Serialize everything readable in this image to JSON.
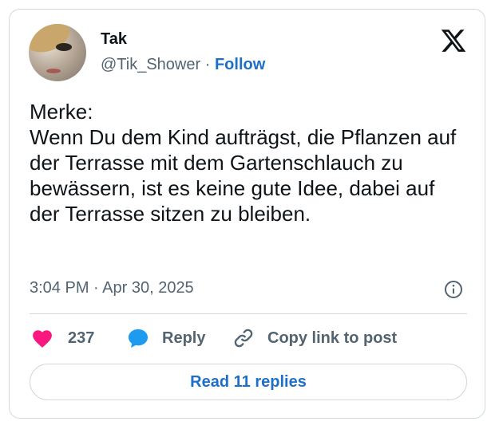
{
  "author": {
    "name": "Tak",
    "handle": "@Tik_Shower",
    "separator": "·",
    "follow_label": "Follow"
  },
  "tweet": {
    "text": "Merke:\nWenn Du dem Kind aufträgst, die Pflanzen auf der Terrasse mit dem Gartenschlauch zu bewässern, ist es keine gute Idee, dabei auf der Terrasse sitzen zu bleiben.",
    "timestamp": "3:04 PM · Apr 30, 2025"
  },
  "actions": {
    "like_count": "237",
    "reply_label": "Reply",
    "copy_label": "Copy link to post"
  },
  "read_replies_label": "Read 11 replies",
  "icons": {
    "logo": "x-logo-icon",
    "info": "info-icon",
    "like": "heart-icon",
    "reply": "speech-bubble-icon",
    "copy": "link-icon"
  },
  "colors": {
    "heart": "#f91880",
    "reply_bubble": "#1d9bf0",
    "link_blue": "#1d6fc9",
    "secondary_text": "#536471",
    "border": "#cfd9de"
  }
}
